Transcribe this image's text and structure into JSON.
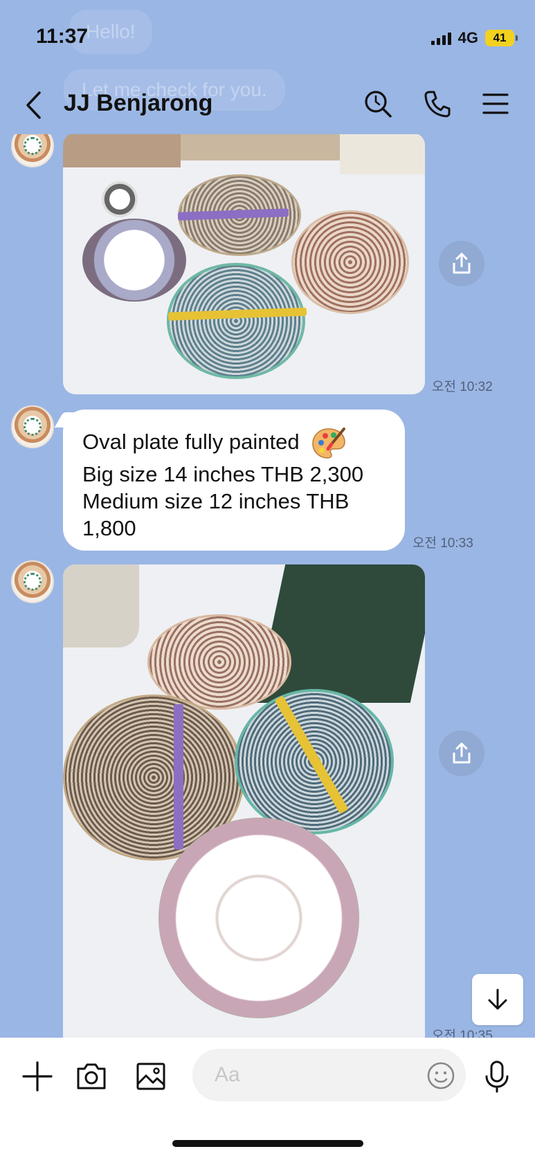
{
  "status_bar": {
    "time": "11:37",
    "network": "4G",
    "battery": "41",
    "battery_color": "#f2d21f"
  },
  "background_ghost": {
    "text1": "Hello!",
    "text2": "Let me check for you."
  },
  "header": {
    "title": "JJ Benjarong",
    "icons": [
      "back-icon",
      "search-icon",
      "phone-icon",
      "menu-icon"
    ]
  },
  "messages": [
    {
      "type": "image",
      "sender": "JJ Benjarong",
      "description_icon": "photo-of-benjarong-plates",
      "time": "오전 10:32"
    },
    {
      "type": "text",
      "sender": "JJ Benjarong",
      "lines": [
        "Oval plate fully painted",
        "Big size 14 inches THB 2,300",
        "Medium size 12 inches THB",
        "1,800"
      ],
      "emoji": "palette-emoji",
      "time": "오전 10:33"
    },
    {
      "type": "image",
      "sender": "JJ Benjarong",
      "description_icon": "photo-of-benjarong-plates",
      "time": "오전 10:35"
    }
  ],
  "input_bar": {
    "placeholder": "Aa",
    "icons": [
      "plus-icon",
      "camera-icon",
      "image-icon",
      "emoji-icon",
      "microphone-icon"
    ]
  },
  "colors": {
    "chat_background": "#9ab6e4",
    "bubble": "#ffffff",
    "timestamp": "#52607a"
  }
}
